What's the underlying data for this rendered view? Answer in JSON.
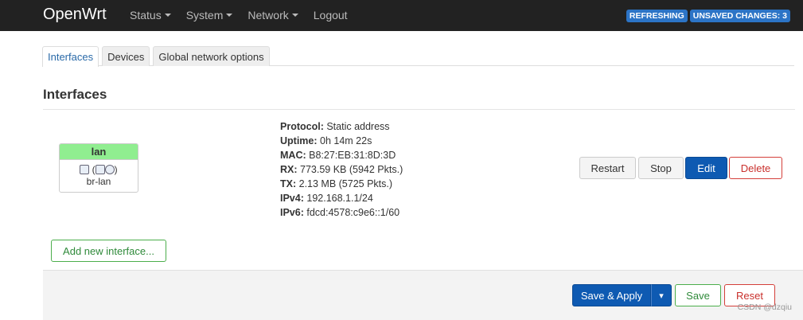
{
  "navbar": {
    "brand": "OpenWrt",
    "menu": [
      {
        "label": "Status"
      },
      {
        "label": "System"
      },
      {
        "label": "Network"
      },
      {
        "label": "Logout"
      }
    ],
    "badges": [
      "REFRESHING",
      "UNSAVED CHANGES: 3"
    ]
  },
  "tabs": [
    "Interfaces",
    "Devices",
    "Global network options"
  ],
  "section": {
    "title": "Interfaces"
  },
  "interface": {
    "name": "lan",
    "icons_text": "(",
    "icons_text_end": ")",
    "device": "br-lan",
    "info": {
      "protocol_label": "Protocol:",
      "protocol": "Static address",
      "uptime_label": "Uptime:",
      "uptime": "0h 14m 22s",
      "mac_label": "MAC:",
      "mac": "B8:27:EB:31:8D:3D",
      "rx_label": "RX:",
      "rx": "773.59 KB (5942 Pkts.)",
      "tx_label": "TX:",
      "tx": "2.13 MB (5725 Pkts.)",
      "ipv4_label": "IPv4:",
      "ipv4": "192.168.1.1/24",
      "ipv6_label": "IPv6:",
      "ipv6": "fdcd:4578:c9e6::1/60"
    },
    "buttons": {
      "restart": "Restart",
      "stop": "Stop",
      "edit": "Edit",
      "delete": "Delete"
    }
  },
  "add_interface": "Add new interface...",
  "footer": {
    "save_apply": "Save & Apply",
    "dropdown": "▾",
    "save": "Save",
    "reset": "Reset"
  },
  "watermark": "CSDN @dzqiu"
}
